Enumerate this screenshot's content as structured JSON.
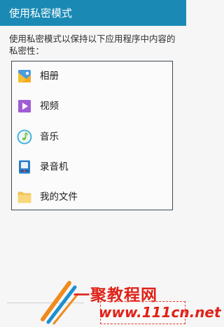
{
  "title_bar": {
    "title": "使用私密模式"
  },
  "description": "使用私密模式以保持以下应用程序中内容的私密性：",
  "apps": [
    {
      "label": "相册",
      "icon": "gallery-icon"
    },
    {
      "label": "视频",
      "icon": "video-icon"
    },
    {
      "label": "音乐",
      "icon": "music-icon"
    },
    {
      "label": "录音机",
      "icon": "voice-recorder-icon"
    },
    {
      "label": "我的文件",
      "icon": "folder-icon"
    }
  ],
  "watermark": {
    "name": "一聚教程网",
    "url": "www.111cn.net"
  },
  "colors": {
    "title_bar": "#1a8ab5",
    "background": "#f6f6f6",
    "watermark_red": "#e02219"
  }
}
